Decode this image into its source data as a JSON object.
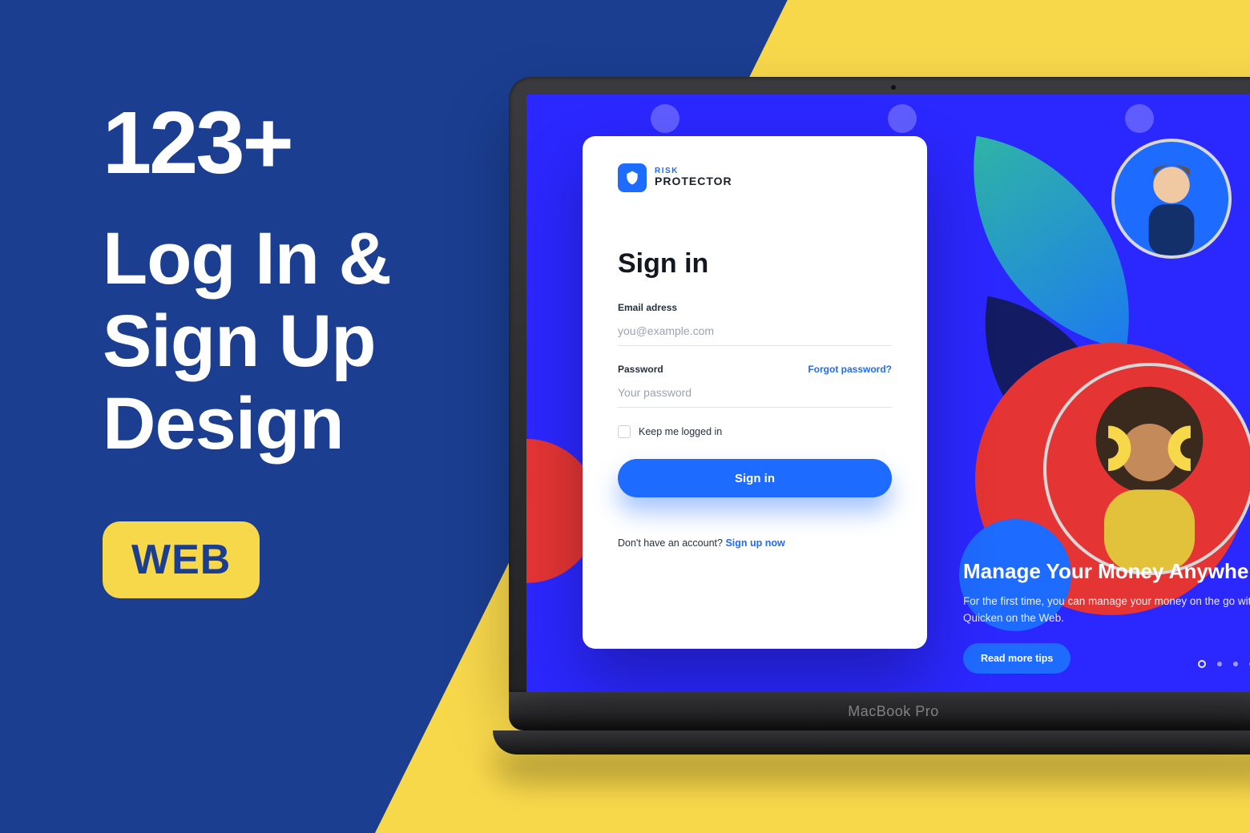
{
  "promo": {
    "count": "123+",
    "line1": "Log In &",
    "line2": "Sign Up",
    "line3": "Design",
    "badge": "WEB"
  },
  "device": {
    "label": "MacBook Pro"
  },
  "brand": {
    "top": "RISK",
    "bottom": "PROTECTOR"
  },
  "signin": {
    "title": "Sign in",
    "email_label": "Email adress",
    "email_placeholder": "you@example.com",
    "password_label": "Password",
    "password_placeholder": "Your password",
    "forgot": "Forgot password?",
    "keep": "Keep me logged in",
    "button": "Sign in",
    "noacct_text": "Don't have an account? ",
    "signup_link": "Sign up now"
  },
  "hero": {
    "title": "Manage Your Money Anywhere",
    "body": "For the first time, you can manage your money on the go with Quicken on the Web.",
    "cta": "Read more tips"
  },
  "colors": {
    "blue_panel": "#1B3E91",
    "yellow": "#F8D84B",
    "screen_blue": "#2B27FF",
    "accent_blue": "#1E6BFF",
    "red": "#E43434"
  }
}
